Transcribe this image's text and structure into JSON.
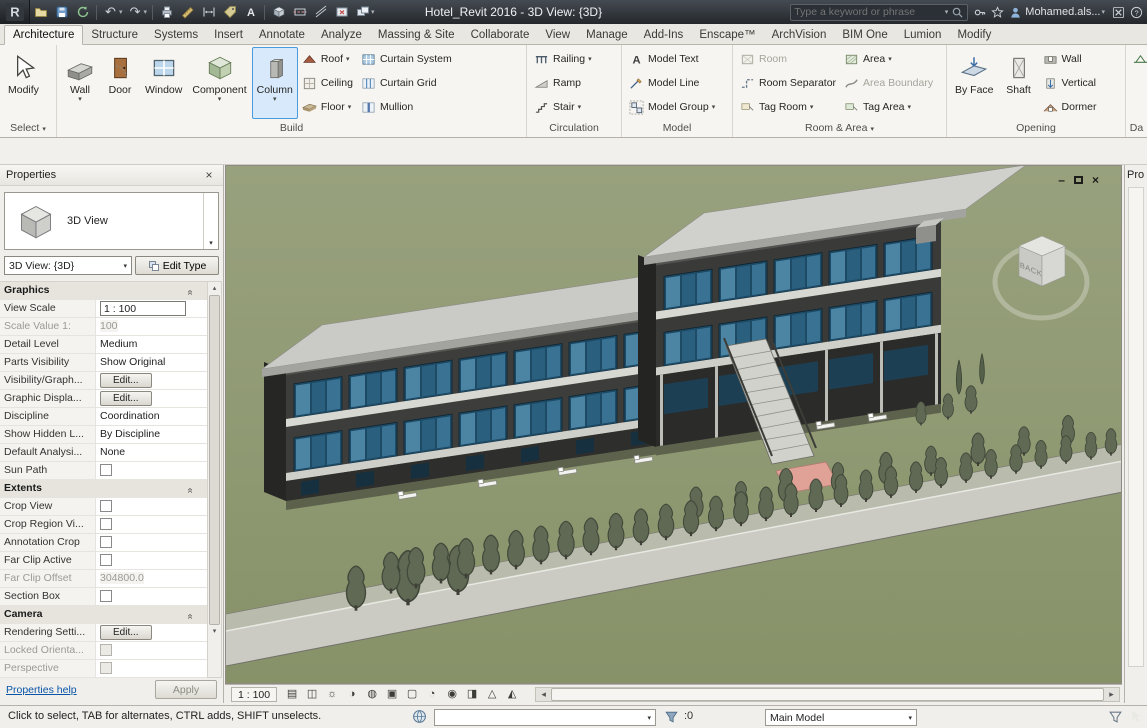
{
  "title_bar": {
    "app_title": "Hotel_Revit 2016 - 3D View: {3D}",
    "search_placeholder": "Type a keyword or phrase",
    "user_name": "Mohamed.als...",
    "qat_icon_names": [
      "open",
      "save",
      "synchronize",
      "undo",
      "redo",
      "print",
      "measure",
      "aligned-dimension",
      "tag-by-category",
      "text",
      "default-3d-view",
      "section",
      "thin-lines",
      "close-hidden-windows",
      "switch-windows"
    ]
  },
  "tabs": [
    {
      "label": "Architecture",
      "cls": "active"
    },
    {
      "label": "Structure"
    },
    {
      "label": "Systems"
    },
    {
      "label": "Insert"
    },
    {
      "label": "Annotate"
    },
    {
      "label": "Analyze"
    },
    {
      "label": "Massing & Site"
    },
    {
      "label": "Collaborate"
    },
    {
      "label": "View"
    },
    {
      "label": "Manage"
    },
    {
      "label": "Add-Ins"
    },
    {
      "label": "Enscape™"
    },
    {
      "label": "ArchVision"
    },
    {
      "label": "BIM One"
    },
    {
      "label": "Lumion"
    },
    {
      "label": "Modify"
    }
  ],
  "ribbon": {
    "select_panel": {
      "label": "Select",
      "modify": "Modify"
    },
    "build_panel": {
      "label": "Build",
      "big_buttons": [
        {
          "name": "wall-button",
          "label": "Wall",
          "icon": "#i-wall",
          "icon_name": "wall-icon",
          "cls": "has-arrow"
        },
        {
          "name": "door-button",
          "label": "Door",
          "icon": "#i-door",
          "icon_name": "door-icon"
        },
        {
          "name": "window-button",
          "label": "Window",
          "icon": "#i-window",
          "icon_name": "window-icon"
        },
        {
          "name": "component-button",
          "label": "Component",
          "icon": "#i-component",
          "icon_name": "component-icon",
          "cls": "has-arrow"
        },
        {
          "name": "column-button",
          "label": "Column",
          "icon": "#i-column",
          "icon_name": "column-icon",
          "cls": "has-arrow active"
        }
      ],
      "small_col1": [
        {
          "name": "roof-button",
          "label": "Roof",
          "icon": "#i-roof",
          "icon_name": "roof-icon",
          "cls": "has-arrow"
        },
        {
          "name": "ceiling-button",
          "label": "Ceiling",
          "icon": "#i-ceiling",
          "icon_name": "ceiling-icon"
        },
        {
          "name": "floor-button",
          "label": "Floor",
          "icon": "#i-floor",
          "icon_name": "floor-icon",
          "cls": "has-arrow"
        }
      ],
      "small_col2": [
        {
          "name": "curtain-system-button",
          "label": "Curtain System",
          "icon": "#i-cursys",
          "icon_name": "curtain-system-icon"
        },
        {
          "name": "curtain-grid-button",
          "label": "Curtain Grid",
          "icon": "#i-curgrid",
          "icon_name": "curtain-grid-icon"
        },
        {
          "name": "mullion-button",
          "label": "Mullion",
          "icon": "#i-mullion",
          "icon_name": "mullion-icon"
        }
      ]
    },
    "circulation_panel": {
      "label": "Circulation",
      "items": [
        {
          "name": "railing-button",
          "label": "Railing",
          "icon": "#i-railing",
          "icon_name": "railing-icon",
          "cls": "has-arrow"
        },
        {
          "name": "ramp-button",
          "label": "Ramp",
          "icon": "#i-ramp",
          "icon_name": "ramp-icon"
        },
        {
          "name": "stair-button",
          "label": "Stair",
          "icon": "#i-stair",
          "icon_name": "stair-icon",
          "cls": "has-arrow"
        }
      ]
    },
    "model_panel": {
      "label": "Model",
      "items": [
        {
          "name": "model-text-button",
          "label": "Model Text",
          "icon": "#i-mtext",
          "icon_name": "model-text-icon"
        },
        {
          "name": "model-line-button",
          "label": "Model Line",
          "icon": "#i-mline",
          "icon_name": "model-line-icon"
        },
        {
          "name": "model-group-button",
          "label": "Model Group",
          "icon": "#i-mgroup",
          "icon_name": "model-group-icon",
          "cls": "has-arrow"
        }
      ]
    },
    "room_area_panel": {
      "label": "Room & Area",
      "col1": [
        {
          "name": "room-button",
          "label": "Room",
          "icon": "#i-room",
          "icon_name": "room-icon",
          "cls": "disabled"
        },
        {
          "name": "room-separator-button",
          "label": "Room Separator",
          "icon": "#i-roomsep",
          "icon_name": "room-separator-icon"
        },
        {
          "name": "tag-room-button",
          "label": "Tag Room",
          "icon": "#i-tagroom",
          "icon_name": "tag-room-icon",
          "cls": "has-arrow"
        }
      ],
      "col2": [
        {
          "name": "area-button",
          "label": "Area",
          "icon": "#i-area",
          "icon_name": "area-icon",
          "cls": "has-arrow"
        },
        {
          "name": "area-boundary-button",
          "label": "Area Boundary",
          "icon": "#i-areabound",
          "icon_name": "area-boundary-icon",
          "cls": "disabled"
        },
        {
          "name": "tag-area-button",
          "label": "Tag Area",
          "icon": "#i-tagarea",
          "icon_name": "tag-area-icon",
          "cls": "has-arrow"
        }
      ]
    },
    "opening_panel": {
      "label": "Opening",
      "big_buttons": [
        {
          "name": "by-face-button",
          "label": "By Face",
          "icon": "#i-byface",
          "icon_name": "by-face-icon"
        },
        {
          "name": "shaft-button",
          "label": "Shaft",
          "icon": "#i-shaft",
          "icon_name": "shaft-icon"
        }
      ],
      "small_buttons": [
        {
          "name": "wall-opening-button",
          "label": "Wall",
          "icon": "#i-openwall",
          "icon_name": "wall-opening-icon"
        },
        {
          "name": "vertical-opening-button",
          "label": "Vertical",
          "icon": "#i-vertical",
          "icon_name": "vertical-opening-icon"
        },
        {
          "name": "dormer-button",
          "label": "Dormer",
          "icon": "#i-dormer",
          "icon_name": "dormer-icon"
        }
      ]
    },
    "partial_panel_label": "Da"
  },
  "properties_panel": {
    "title": "Properties",
    "type_selector": {
      "family": "3D View"
    },
    "view_selector": "3D View: {3D}",
    "edit_type_label": "Edit Type",
    "rows": [
      {
        "cls": "k-section",
        "label": "Graphics"
      },
      {
        "cls": "k-input",
        "label": "View Scale",
        "value": "1 : 100"
      },
      {
        "cls": "k-text k-disabled",
        "label": "Scale Value    1:",
        "value": "100"
      },
      {
        "cls": "k-text",
        "label": "Detail Level",
        "value": "Medium"
      },
      {
        "cls": "k-text",
        "label": "Parts Visibility",
        "value": "Show Original"
      },
      {
        "cls": "k-button",
        "label": "Visibility/Graph...",
        "value": "Edit..."
      },
      {
        "cls": "k-button",
        "label": "Graphic Displa...",
        "value": "Edit..."
      },
      {
        "cls": "k-text",
        "label": "Discipline",
        "value": "Coordination"
      },
      {
        "cls": "k-text",
        "label": "Show Hidden L...",
        "value": "By Discipline"
      },
      {
        "cls": "k-text",
        "label": "Default Analysi...",
        "value": "None"
      },
      {
        "cls": "k-check",
        "label": "Sun Path"
      },
      {
        "cls": "k-section",
        "label": "Extents"
      },
      {
        "cls": "k-check",
        "label": "Crop View"
      },
      {
        "cls": "k-check",
        "label": "Crop Region Vi..."
      },
      {
        "cls": "k-check",
        "label": "Annotation Crop"
      },
      {
        "cls": "k-check",
        "label": "Far Clip Active"
      },
      {
        "cls": "k-text k-disabled",
        "label": "Far Clip Offset",
        "value": "304800.0"
      },
      {
        "cls": "k-check",
        "label": "Section Box"
      },
      {
        "cls": "k-section",
        "label": "Camera"
      },
      {
        "cls": "k-button",
        "label": "Rendering Setti...",
        "value": "Edit..."
      },
      {
        "cls": "k-check k-disabled",
        "label": "Locked Orienta..."
      },
      {
        "cls": "k-check k-disabled",
        "label": "Perspective"
      }
    ],
    "help_link": "Properties help",
    "apply_label": "Apply"
  },
  "viewport": {
    "viewcube_back_label": "BACK"
  },
  "view_control_bar": {
    "scale": "1 : 100",
    "icons": [
      {
        "name": "detail-level-icon",
        "glyph": "▤"
      },
      {
        "name": "visual-style-icon",
        "glyph": "◫"
      },
      {
        "name": "sun-path-icon",
        "glyph": "☼"
      },
      {
        "name": "shadows-icon",
        "glyph": "◑"
      },
      {
        "name": "rendering-dialog-icon",
        "glyph": "◍"
      },
      {
        "name": "crop-view-icon",
        "glyph": "▣"
      },
      {
        "name": "show-crop-region-icon",
        "glyph": "▢"
      },
      {
        "name": "temporary-hide-isolate-icon",
        "glyph": "◔"
      },
      {
        "name": "reveal-hidden-elements-icon",
        "glyph": "◉"
      },
      {
        "name": "temporary-view-properties-icon",
        "glyph": "◨"
      },
      {
        "name": "show-analytical-model-icon",
        "glyph": "△"
      },
      {
        "name": "highlight-displacement-icon",
        "glyph": "◭"
      }
    ]
  },
  "status_bar": {
    "message": "Click to select, TAB for alternates, CTRL adds, SHIFT unselects.",
    "selection_count": ":0",
    "design_option": "Main Model"
  },
  "right_strip": {
    "label": "Pro"
  },
  "icons": {
    "app_logo": "R",
    "dropdown_arrow": "▾",
    "close": "×",
    "minimize": "–",
    "section_chevron": "«",
    "left_arrow": "◂",
    "right_arrow": "▸",
    "up_arrow": "▴",
    "down_arrow": "▾",
    "undo": "↶",
    "redo": "↷",
    "help": "?",
    "text_tool": "A"
  }
}
